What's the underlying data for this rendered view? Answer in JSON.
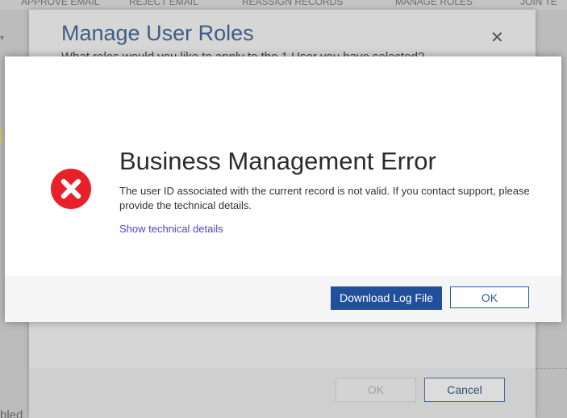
{
  "background": {
    "toolbar": {
      "items": [
        "APPROVE EMAIL",
        "REJECT EMAIL",
        "REASSIGN RECORDS",
        "MANAGE ROLES",
        "JOIN TE"
      ]
    },
    "left_text_fragment": "bled"
  },
  "roles_dialog": {
    "title": "Manage User Roles",
    "close_glyph": "✕",
    "subtitle": "What roles would you like to apply to the 1 User you have selected?",
    "ok_label": "OK",
    "cancel_label": "Cancel"
  },
  "error_dialog": {
    "icon": "error-circle-x-icon",
    "title": "Business Management Error",
    "message": "The user ID associated with the current record is not valid. If you contact support, please provide the technical details.",
    "link_label": "Show technical details",
    "download_label": "Download Log File",
    "ok_label": "OK"
  },
  "colors": {
    "error_red": "#e8202a",
    "primary_blue": "#1f4f9d",
    "link_purple": "#5b3fc7",
    "title_blue": "#3f5d86"
  }
}
